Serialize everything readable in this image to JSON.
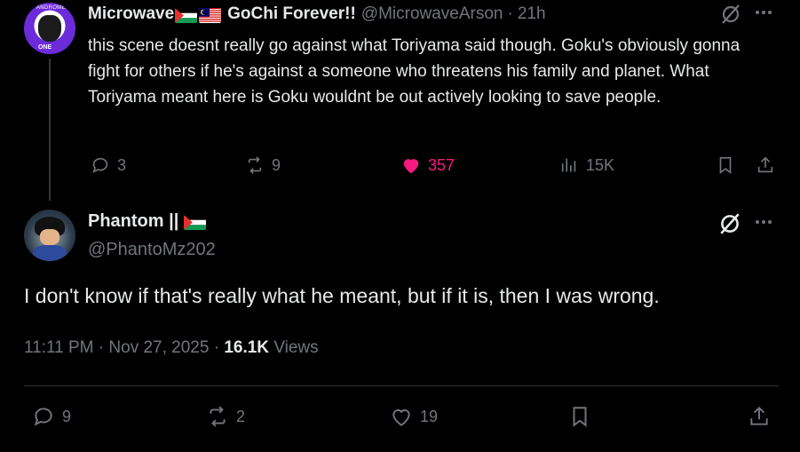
{
  "parent": {
    "display_name": "Microwave",
    "display_name_suffix": "GoChi Forever!!",
    "handle": "@MicrowaveArson",
    "time": "21h",
    "text": "this scene doesnt really go against what Toriyama said though. Goku's obviously gonna fight for others if he's against a someone who threatens his family and planet. What Toriyama meant here is Goku wouldnt be out actively looking to save people.",
    "replies": "3",
    "reposts": "9",
    "likes": "357",
    "views": "15K",
    "like_color": "#f91880"
  },
  "reply": {
    "display_name": "Phantom ||",
    "handle": "@PhantoMz202",
    "text": "I don't know if that's really what he meant, but if it is, then I was wrong.",
    "time": "11:11 PM",
    "date": "Nov 27, 2025",
    "views_count": "16.1K",
    "views_label": "Views",
    "replies": "9",
    "reposts": "2",
    "likes": "19"
  },
  "icons": {
    "grok": "grok-icon",
    "more": "more-icon",
    "reply": "reply-icon",
    "repost": "repost-icon",
    "like": "heart-icon",
    "views": "views-icon",
    "bookmark": "bookmark-icon",
    "share": "share-icon"
  },
  "colors": {
    "background": "#000000",
    "muted": "#71767b",
    "text": "#e7e9ea"
  }
}
